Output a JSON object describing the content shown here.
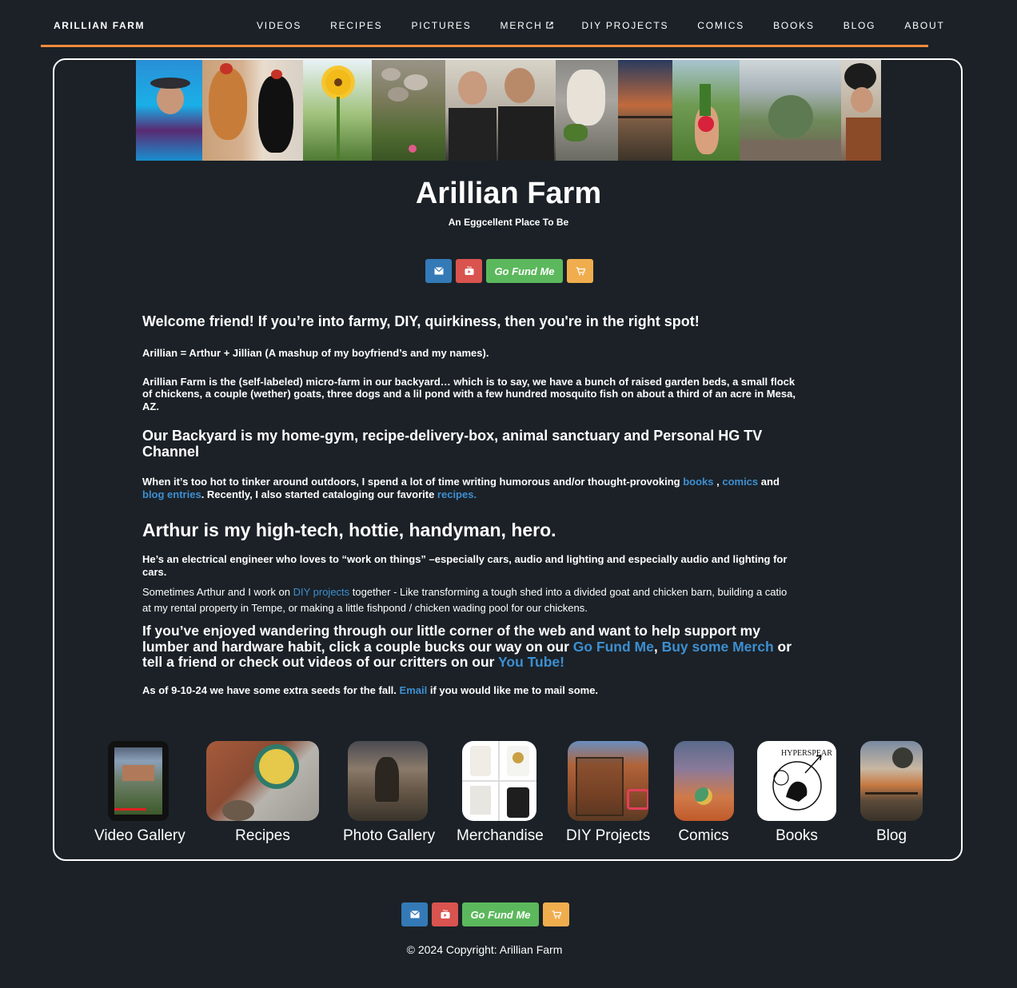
{
  "nav": {
    "brand": "ARILLIAN FARM",
    "items": [
      {
        "label": "VIDEOS"
      },
      {
        "label": "RECIPES"
      },
      {
        "label": "PICTURES"
      },
      {
        "label": "MERCH",
        "external_icon": "external-link-icon"
      },
      {
        "label": "DIY PROJECTS"
      },
      {
        "label": "COMICS"
      },
      {
        "label": "BOOKS"
      },
      {
        "label": "BLOG"
      },
      {
        "label": "ABOUT"
      }
    ],
    "accent_color": "#f08a3c"
  },
  "header": {
    "title": "Arillian Farm",
    "tagline": "An Eggcellent Place To Be"
  },
  "social": {
    "email_icon": "envelope-icon",
    "youtube_icon": "youtube-icon",
    "gofundme_label": "Go Fund Me",
    "cart_icon": "shopping-cart-icon",
    "colors": {
      "email": "#337ab7",
      "youtube": "#d9534f",
      "gofundme": "#5cb85c",
      "cart": "#f0ad4e"
    }
  },
  "content": {
    "welcome": "Welcome friend! If you’re into farmy, DIY, quirkiness, then you're in the right spot!",
    "name_explain": "Arillian = Arthur + Jillian (A mashup of my boyfriend’s and my names).",
    "farm_desc": "Arillian Farm is the (self-labeled) micro-farm in our backyard… which is to say, we have a bunch of raised garden beds, a small flock of chickens, a couple (wether) goats, three dogs and a lil pond with a few hundred mosquito fish on about a third of an acre in Mesa, AZ.",
    "backyard_heading": "Our Backyard is my home-gym, recipe-delivery-box, animal sanctuary and Personal HG TV Channel",
    "writing_p": {
      "t1": "When it’s too hot to tinker around outdoors, I spend a lot of time writing humorous and/or thought-provoking ",
      "link_books": "books",
      "t2": " , ",
      "link_comics": "comics",
      "t3": " and ",
      "link_blog": "blog entries",
      "t4": ". Recently, I also started cataloging our favorite ",
      "link_recipes": "recipes."
    },
    "arthur_heading": "Arthur is my high-tech, hottie, handyman, hero.",
    "arthur_desc": "He’s an electrical engineer who loves to “work on things” –especially cars, audio and lighting and especially audio and lighting for cars.",
    "diy_p": {
      "t1": "Sometimes Arthur and I work on ",
      "link_diy": "DIY projects",
      "t2": " together - Like transforming a tough shed into a divided goat and chicken barn, building a catio at my rental property in Tempe, or making a little fishpond / chicken wading pool for our chickens."
    },
    "support_p": {
      "t1": "If you’ve enjoyed wandering through our little corner of the web and want to help support my lumber and hardware habit, click a couple bucks our way on our ",
      "link_gfm": "Go Fund Me",
      "t2": ", ",
      "link_merch": "Buy some Merch",
      "t3": " or tell a friend or check out videos of our critters on our ",
      "link_yt": "You Tube!"
    },
    "seeds_p": {
      "t1": "As of 9-10-24 we have some extra seeds for the fall. ",
      "link_email": "Email",
      "t2": " if you would like me to mail some."
    }
  },
  "gallery": [
    {
      "label": "Video Gallery"
    },
    {
      "label": "Recipes"
    },
    {
      "label": "Photo Gallery"
    },
    {
      "label": "Merchandise"
    },
    {
      "label": "DIY Projects"
    },
    {
      "label": "Comics"
    },
    {
      "label": "Books",
      "thumb_text": "HYPERSPEAR"
    },
    {
      "label": "Blog"
    }
  ],
  "footer": {
    "gofundme_label": "Go Fund Me",
    "copyright": "© 2024 Copyright: Arillian Farm"
  }
}
